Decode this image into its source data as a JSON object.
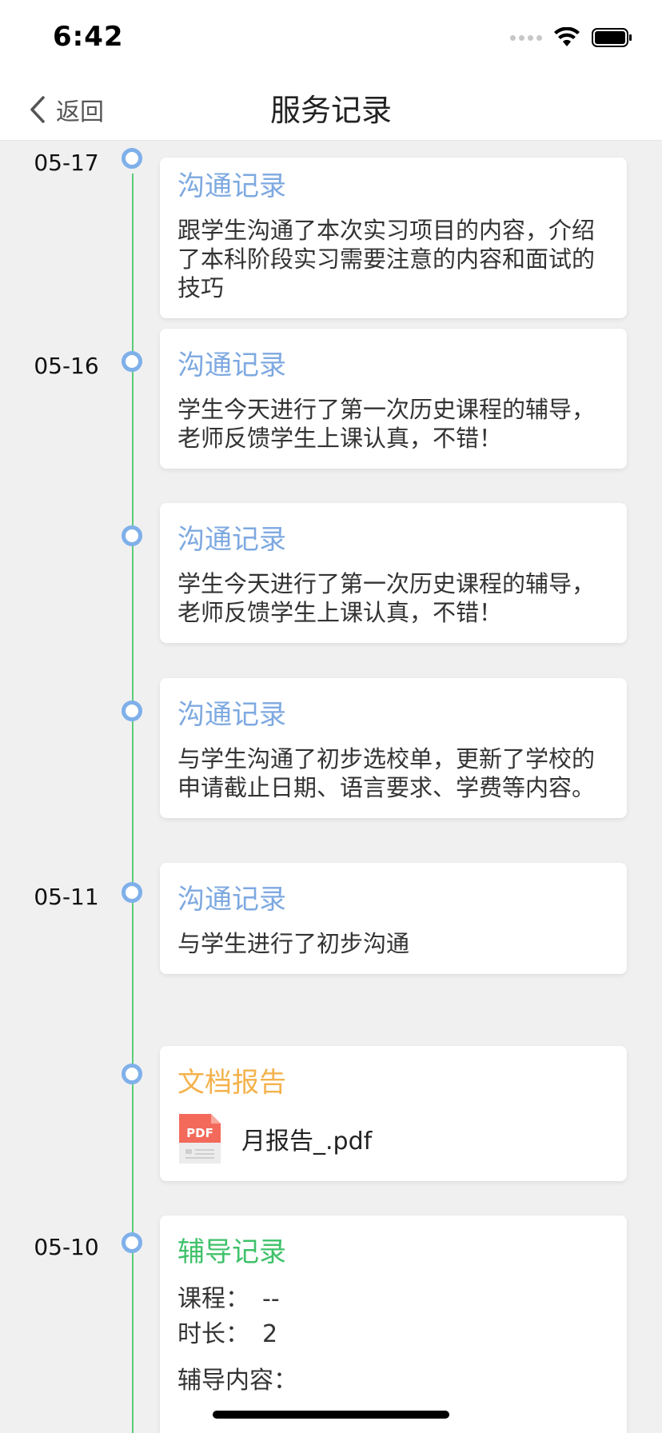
{
  "status_bar": {
    "time": "6:42"
  },
  "nav": {
    "back_label": "返回",
    "title": "服务记录"
  },
  "entries": [
    {
      "date": "05-17",
      "title": "沟通记录",
      "text": "跟学生沟通了本次实习项目的内容，介绍了本科阶段实习需要注意的内容和面试的技巧"
    },
    {
      "date": "05-16",
      "title": "沟通记录",
      "text": "学生今天进行了第一次历史课程的辅导，老师反馈学生上课认真，不错！"
    },
    {
      "date": "",
      "title": "沟通记录",
      "text": "学生今天进行了第一次历史课程的辅导，老师反馈学生上课认真，不错！"
    },
    {
      "date": "",
      "title": "沟通记录",
      "text": "与学生沟通了初步选校单，更新了学校的申请截止日期、语言要求、学费等内容。"
    },
    {
      "date": "05-11",
      "title": "沟通记录",
      "text": "与学生进行了初步沟通"
    },
    {
      "date": "",
      "title": "文档报告",
      "file_icon_label": "PDF",
      "file_name": "月报告_.pdf"
    },
    {
      "date": "05-10",
      "title": "辅导记录",
      "course_label": "课程：",
      "course_value": "--",
      "duration_label": "时长：",
      "duration_value": "2",
      "content_label": "辅导内容："
    }
  ],
  "colors": {
    "comm_title": "#7ea9e1",
    "doc_title": "#f4b24c",
    "tutor_title": "#3fc16a",
    "timeline": "#5ccc7a",
    "dot": "#7fb0ea"
  }
}
